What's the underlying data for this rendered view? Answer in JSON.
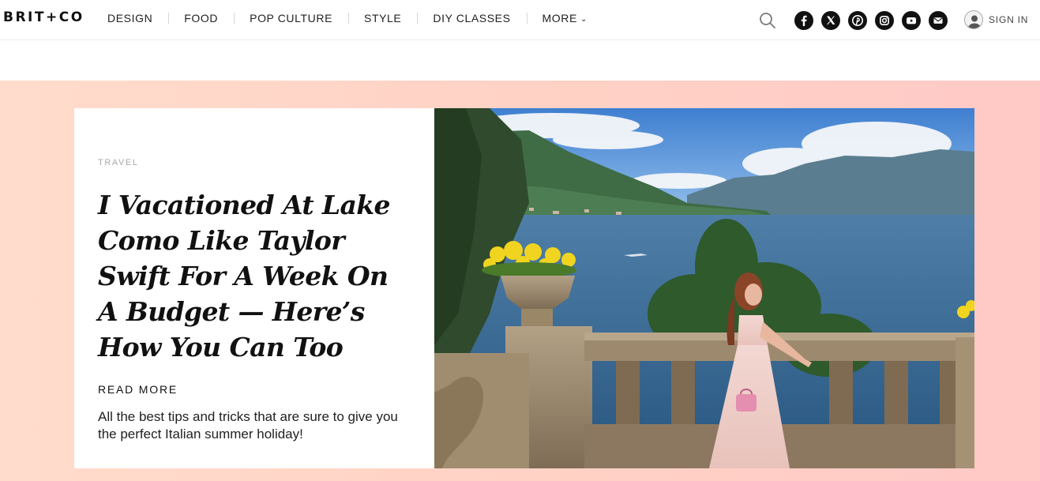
{
  "brand": {
    "logo": "BRIT+CO"
  },
  "nav": {
    "items": [
      {
        "label": "DESIGN"
      },
      {
        "label": "FOOD"
      },
      {
        "label": "POP CULTURE"
      },
      {
        "label": "STYLE"
      },
      {
        "label": "DIY CLASSES"
      },
      {
        "label": "MORE"
      }
    ]
  },
  "header": {
    "search_icon": "search-icon",
    "socials": [
      "facebook-icon",
      "x-icon",
      "pinterest-icon",
      "instagram-icon",
      "youtube-icon",
      "email-icon"
    ],
    "signin_label": "SIGN IN"
  },
  "hero": {
    "category": "TRAVEL",
    "headline": "I Vacationed At Lake Como Like Taylor Swift For A Week On A Budget — Here’s How You Can Too",
    "cta": "READ MORE",
    "dek": "All the best tips and tricks that are sure to give you the perfect Italian summer holiday!"
  },
  "colors": {
    "hero_bg_start": "#ffdccc",
    "hero_bg_end": "#ffc9c6",
    "highlight": "#ffe94a",
    "icon_bg": "#111111"
  }
}
